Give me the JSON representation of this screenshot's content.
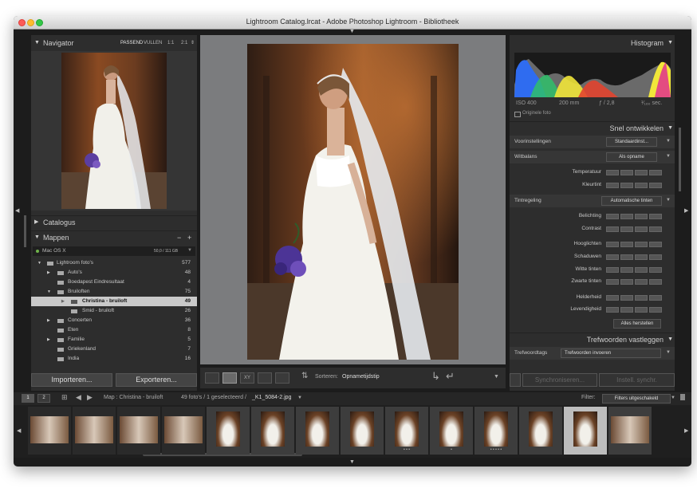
{
  "window": {
    "title": "Lightroom Catalog.lrcat - Adobe Photoshop Lightroom - Bibliotheek"
  },
  "navigator": {
    "title": "Navigator",
    "fit": "PASSEND",
    "fill": "VULLEN",
    "ratio1": "1:1",
    "ratio2": "2:1"
  },
  "catalog": {
    "title": "Catalogus"
  },
  "folders": {
    "title": "Mappen",
    "volume": "Mac OS X",
    "volume_info": "50,0 / 111 GB",
    "items": [
      {
        "label": "Lightroom foto's",
        "count": "577"
      },
      {
        "label": "Auto's",
        "count": "48"
      },
      {
        "label": "Boedapest Eindresultaat",
        "count": "4"
      },
      {
        "label": "Bruiloften",
        "count": "75"
      },
      {
        "label": "Christina - bruiloft",
        "count": "49"
      },
      {
        "label": "Smid - bruiloft",
        "count": "26"
      },
      {
        "label": "Concerten",
        "count": "36"
      },
      {
        "label": "Eten",
        "count": "8"
      },
      {
        "label": "Familie",
        "count": "5"
      },
      {
        "label": "Griekenland",
        "count": "7"
      },
      {
        "label": "India",
        "count": "16"
      }
    ]
  },
  "left_buttons": {
    "import": "Importeren...",
    "export": "Exporteren..."
  },
  "toolbar": {
    "sort_label": "Sorteren:",
    "sort_value": "Opnametijdstip"
  },
  "histogram": {
    "title": "Histogram",
    "iso": "ISO 400",
    "focal": "200 mm",
    "aperture": "ƒ / 2,8",
    "shutter": "¹⁄₁₆₀ sec.",
    "original": "Originele foto"
  },
  "quick_develop": {
    "title": "Snel ontwikkelen",
    "presets_label": "Voorinstellingen",
    "presets_value": "Standaardinst...",
    "wb_label": "Witbalans",
    "wb_value": "Als opname",
    "temp": "Temperatuur",
    "tint": "Kleurtint",
    "tone_label": "Tintregeling",
    "auto_tone": "Automatische tinten",
    "exposure": "Belichting",
    "contrast": "Contrast",
    "highlights": "Hooglichten",
    "shadows": "Schaduwen",
    "whites": "Witte tinten",
    "blacks": "Zwarte tinten",
    "clarity": "Helderheid",
    "vibrance": "Levendigheid",
    "reset": "Alles herstellen"
  },
  "keywords": {
    "title": "Trefwoorden vastleggen",
    "tags_label": "Trefwoordtags",
    "tags_value": "Trefwoorden invoeren"
  },
  "right_buttons": {
    "sync": "Synchroniseren...",
    "sync_settings": "Instell. synchr."
  },
  "filmstrip_bar": {
    "page1": "1",
    "page2": "2",
    "path": "Map : Christina - bruiloft",
    "count": "49 foto's / 1 geselecteerd /",
    "file": "_K1_5084-2.jpg",
    "filter_label": "Filter:",
    "filter_value": "Filters uitgeschakeld"
  },
  "filmstrip": {
    "stars": [
      "",
      "",
      "",
      "",
      "",
      "",
      "",
      "",
      "• • •",
      "•",
      "• • • • •",
      "",
      "",
      ""
    ]
  }
}
